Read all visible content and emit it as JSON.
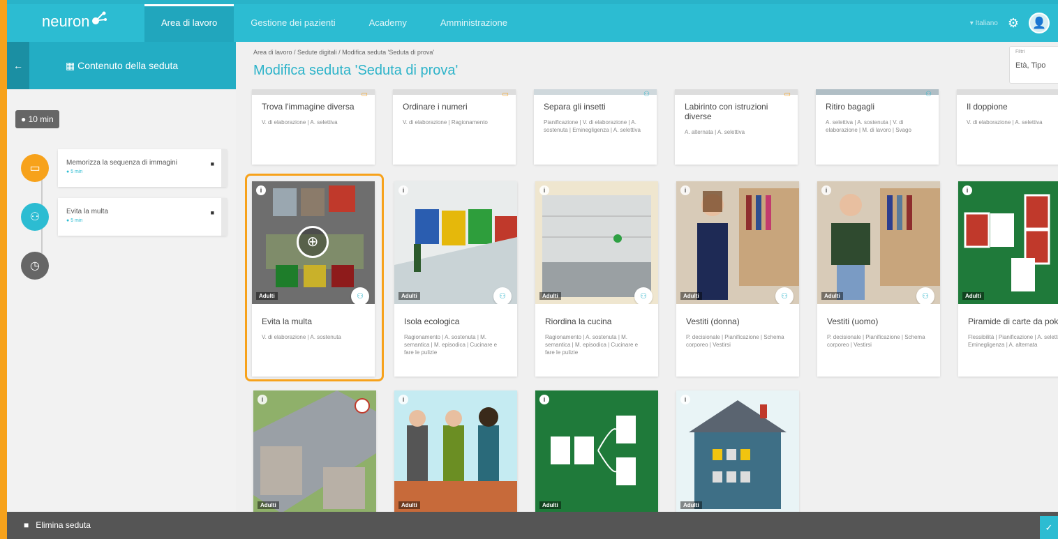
{
  "header": {
    "logo": "neuron",
    "nav": [
      "Area di lavoro",
      "Gestione dei pazienti",
      "Academy",
      "Amministrazione"
    ],
    "language": "Italiano"
  },
  "sidebar": {
    "title": "Contenuto della seduta",
    "duration": "10 min",
    "items": [
      {
        "title": "Memorizza la sequenza di immagini",
        "duration": "5 min"
      },
      {
        "title": "Evita la multa",
        "duration": "5 min"
      }
    ]
  },
  "breadcrumb": [
    "Area di lavoro",
    "Sedute digitali",
    "Modifica seduta 'Seduta di prova'"
  ],
  "page_title": "Modifica seduta 'Seduta di prova'",
  "filter": {
    "label": "Filtri",
    "value": "Età, Tipo"
  },
  "cards_top": [
    {
      "name": "Trova l'immagine diversa",
      "desc": "V. di elaborazione | A. selettiva"
    },
    {
      "name": "Ordinare i numeri",
      "desc": "V. di elaborazione | Ragionamento"
    },
    {
      "name": "Separa gli insetti",
      "desc": "Pianificazione | V. di elaborazione | A. sostenuta | Eminegligenza | A. selettiva"
    },
    {
      "name": "Labirinto con istruzioni diverse",
      "desc": "A. alternata | A. selettiva"
    },
    {
      "name": "Ritiro bagagli",
      "desc": "A. selettiva | A. sostenuta | V. di elaborazione | M. di lavoro | Svago"
    },
    {
      "name": "Il doppione",
      "desc": "V. di elaborazione | A. selettiva"
    }
  ],
  "cards_mid": [
    {
      "name": "Evita la multa",
      "desc": "V. di elaborazione | A. sostenuta",
      "tag": "Adulti"
    },
    {
      "name": "Isola ecologica",
      "desc": "Ragionamento | A. sostenuta | M. semantica | M. episodica | Cucinare e fare le pulizie",
      "tag": "Adulti"
    },
    {
      "name": "Riordina la cucina",
      "desc": "Ragionamento | A. sostenuta | M. semantica | M. episodica | Cucinare e fare le pulizie",
      "tag": "Adulti"
    },
    {
      "name": "Vestiti (donna)",
      "desc": "P. decisionale | Pianificazione | Schema corporeo | Vestirsi",
      "tag": "Adulti"
    },
    {
      "name": "Vestiti (uomo)",
      "desc": "P. decisionale | Pianificazione | Schema corporeo | Vestirsi",
      "tag": "Adulti"
    },
    {
      "name": "Piramide di carte da poker",
      "desc": "Flessibilità | Pianificazione | A. selettiva | Eminegligenza | A. alternata",
      "tag": "Adulti"
    }
  ],
  "cards_bottom_tags": [
    "Adulti",
    "Adulti",
    "Adulti",
    "Adulti"
  ],
  "bottombar": {
    "delete_label": "Elimina seduta"
  }
}
